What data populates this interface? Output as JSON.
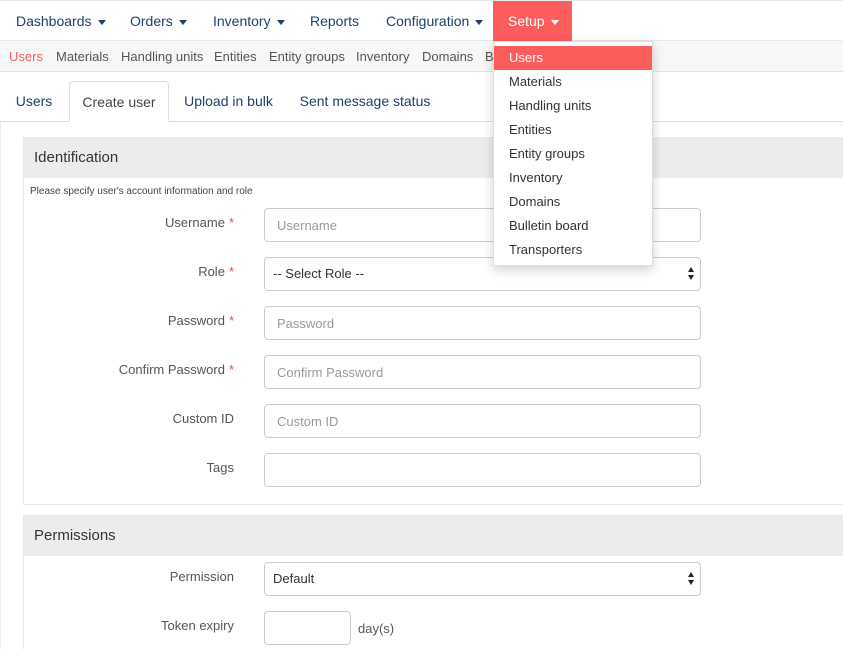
{
  "topnav": {
    "items": [
      {
        "label": "Dashboards",
        "has_caret": true
      },
      {
        "label": "Orders",
        "has_caret": true
      },
      {
        "label": "Inventory",
        "has_caret": true
      },
      {
        "label": "Reports",
        "has_caret": false
      },
      {
        "label": "Configuration",
        "has_caret": true
      },
      {
        "label": "Setup",
        "has_caret": true,
        "active": true
      }
    ]
  },
  "subnav": {
    "items": [
      "Users",
      "Materials",
      "Handling units",
      "Entities",
      "Entity groups",
      "Inventory",
      "Domains",
      "B"
    ],
    "active": "Users"
  },
  "tabs": {
    "items": [
      "Users",
      "Create user",
      "Upload in bulk",
      "Sent message status"
    ],
    "active": "Create user"
  },
  "identification": {
    "title": "Identification",
    "hint": "Please specify user's account information and role",
    "required_marker": "*",
    "fields": {
      "username": {
        "label": "Username",
        "placeholder": "Username"
      },
      "role": {
        "label": "Role",
        "value": "-- Select Role --"
      },
      "password": {
        "label": "Password",
        "placeholder": "Password"
      },
      "confirm_password": {
        "label": "Confirm Password",
        "placeholder": "Confirm Password"
      },
      "custom_id": {
        "label": "Custom ID",
        "placeholder": "Custom ID"
      },
      "tags": {
        "label": "Tags",
        "placeholder": ""
      }
    }
  },
  "permissions": {
    "title": "Permissions",
    "fields": {
      "permission": {
        "label": "Permission",
        "value": "Default"
      },
      "token_expiry": {
        "label": "Token expiry",
        "unit": "day(s)"
      }
    }
  },
  "setup_menu": {
    "items": [
      "Users",
      "Materials",
      "Handling units",
      "Entities",
      "Entity groups",
      "Inventory",
      "Domains",
      "Bulletin board",
      "Transporters"
    ],
    "active": "Users"
  },
  "colors": {
    "accent": "#fb5d5d",
    "nav_text": "#1f3f6e",
    "required": "#e84b4b"
  }
}
